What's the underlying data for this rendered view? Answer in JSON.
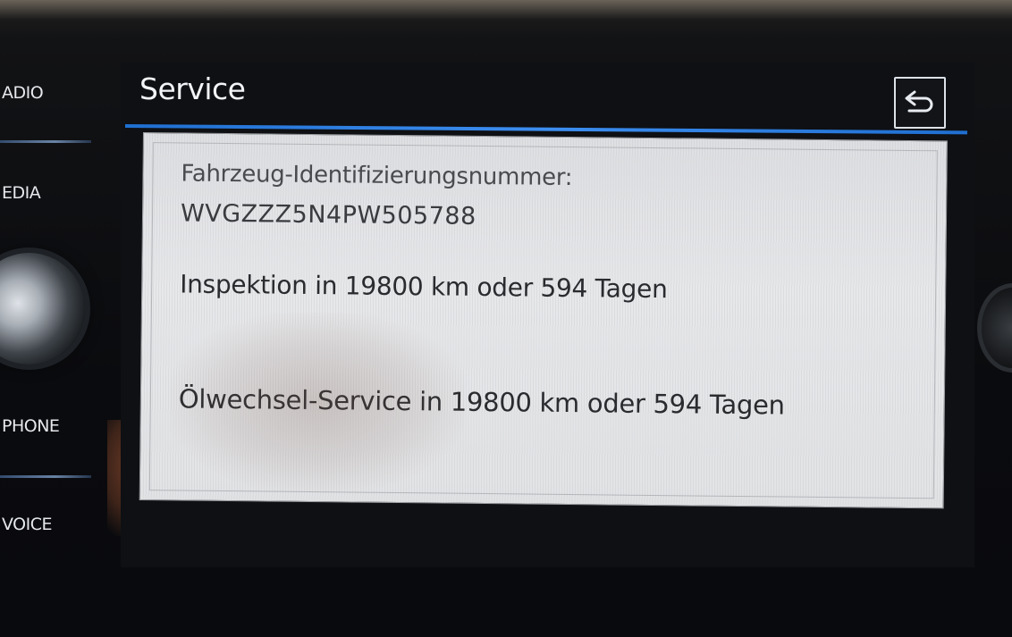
{
  "side_buttons": [
    {
      "label": "ADIO"
    },
    {
      "label": "EDIA"
    },
    {
      "label": "PHONE"
    },
    {
      "label": "VOICE"
    }
  ],
  "screen": {
    "title": "Service",
    "back_icon": "back-arrow-icon"
  },
  "panel": {
    "vin_label": "Fahrzeug-Identifizierungsnummer:",
    "vin_value": "WVGZZZ5N4PW505788",
    "inspection": "Inspektion in 19800 km oder 594 Tagen",
    "oil_service": "Ölwechsel-Service in 19800 km oder 594 Tagen"
  },
  "colors": {
    "accent_line": "#2f80e8",
    "panel_bg": "#e3e4e6",
    "text": "#2a2b2e"
  }
}
